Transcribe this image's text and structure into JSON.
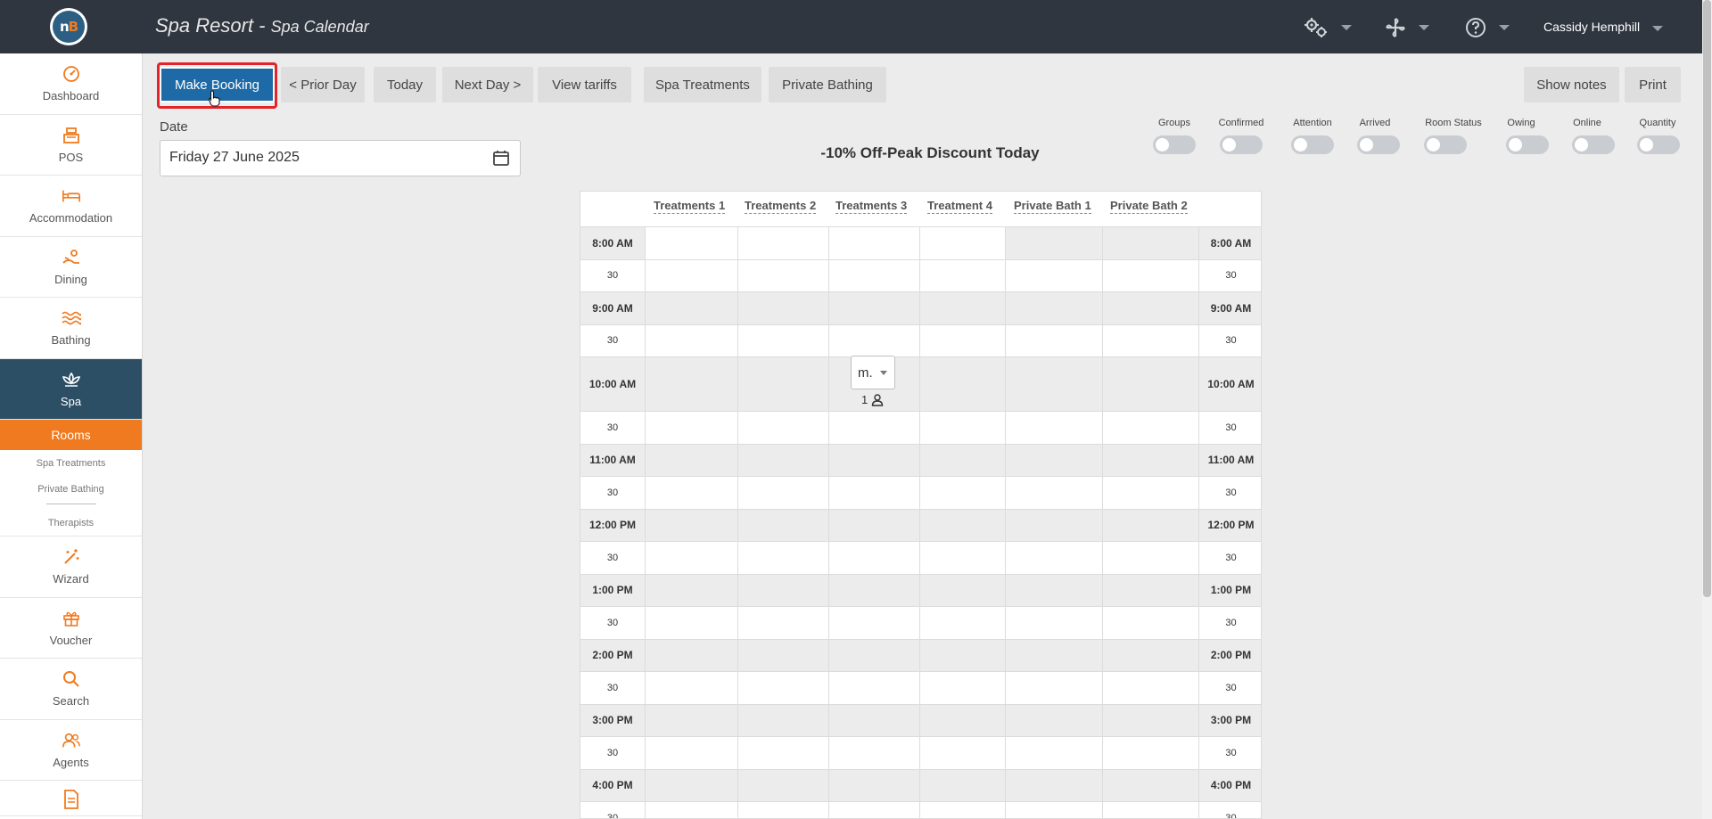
{
  "app": {
    "logo_text": "nB",
    "title": "Spa Resort",
    "subtitle": "Spa Calendar",
    "user_name": "Cassidy Hemphill"
  },
  "topbar_icons": [
    "settings-icon",
    "connect-icon",
    "help-icon"
  ],
  "sidebar": {
    "items": [
      {
        "label": "Dashboard",
        "icon": "dashboard-icon"
      },
      {
        "label": "POS",
        "icon": "pos-register-icon"
      },
      {
        "label": "Accommodation",
        "icon": "bed-icon"
      },
      {
        "label": "Dining",
        "icon": "dining-icon"
      },
      {
        "label": "Bathing",
        "icon": "waves-icon"
      },
      {
        "label": "Spa",
        "icon": "lotus-icon",
        "active": true
      }
    ],
    "spa_sub": {
      "active": "Rooms",
      "links": [
        "Spa Treatments",
        "Private Bathing",
        "Therapists"
      ]
    },
    "items_after": [
      {
        "label": "Wizard",
        "icon": "magic-wand-icon"
      },
      {
        "label": "Voucher",
        "icon": "gift-icon"
      },
      {
        "label": "Search",
        "icon": "search-icon"
      },
      {
        "label": "Agents",
        "icon": "agents-icon"
      }
    ]
  },
  "toolbar": {
    "make_booking": "Make Booking",
    "prior_day": "< Prior Day",
    "today": "Today",
    "next_day": "Next Day >",
    "view_tariffs": "View tariffs",
    "spa_treatments": "Spa Treatments",
    "private_bathing": "Private Bathing",
    "show_notes": "Show notes",
    "print": "Print"
  },
  "date": {
    "label": "Date",
    "value": "Friday 27 June 2025"
  },
  "discount_banner": "-10% Off-Peak Discount Today",
  "filters": [
    "Groups",
    "Confirmed",
    "Attention",
    "Arrived",
    "Room Status",
    "Owing",
    "Online",
    "Quantity"
  ],
  "calendar": {
    "columns": [
      "Treatments 1",
      "Treatments 2",
      "Treatments 3",
      "Treatment 4",
      "Private Bath 1",
      "Private Bath 2"
    ],
    "rows": [
      "8:00 AM",
      "30",
      "9:00 AM",
      "30",
      "10:00 AM",
      "30",
      "11:00 AM",
      "30",
      "12:00 PM",
      "30",
      "1:00 PM",
      "30",
      "2:00 PM",
      "30",
      "3:00 PM",
      "30",
      "4:00 PM",
      "30"
    ],
    "booking": {
      "select_value": "m.",
      "guest_count": "1"
    }
  },
  "colors": {
    "topbar": "#2f3640",
    "accent_orange": "#f07a1f",
    "spa_active": "#2c4f66",
    "primary_button": "#1e6aa6",
    "highlight_red": "#e0262b"
  }
}
